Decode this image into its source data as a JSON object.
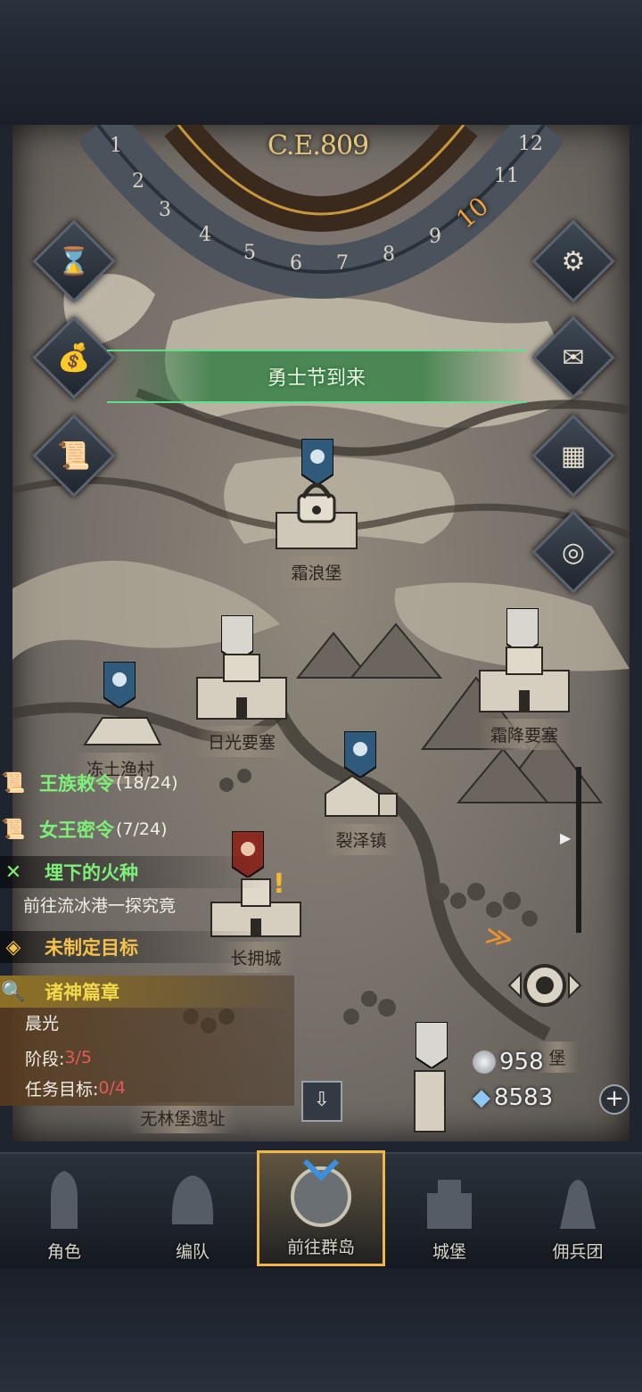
{
  "header": {
    "era": "C.E.809",
    "months": [
      "1",
      "2",
      "3",
      "4",
      "5",
      "6",
      "7",
      "8",
      "9",
      "10",
      "11",
      "12"
    ],
    "current_month": "10"
  },
  "side_buttons": {
    "left": [
      "hourglass-icon",
      "money-bag-icon",
      "scroll-icon"
    ],
    "right": [
      "gear-icon",
      "mail-icon",
      "board-icon",
      "drum-icon"
    ]
  },
  "event_banner": "勇士节到来",
  "locations": {
    "frost_wave_fort": "霜浪堡",
    "sunlight_fortress": "日光要塞",
    "frost_fortress": "霜降要塞",
    "frozen_fishing_village": "冻土渔村",
    "rift_town": "裂泽镇",
    "embrace_city": "长拥城",
    "ruins": "无林堡遗址",
    "fort_partial": "堡"
  },
  "quests": {
    "royal_decree": {
      "title": "王族敕令",
      "progress": "(18/24)"
    },
    "queen_secret": {
      "title": "女王密令",
      "progress": "(7/24)"
    },
    "buried_fire": {
      "title": "埋下的火种",
      "desc": "前往流冰港一探究竟"
    },
    "no_goal": {
      "title": "未制定目标"
    },
    "gods_chapter": {
      "title": "诸神篇章",
      "name": "晨光",
      "stage_label": "阶段:",
      "stage_value": "3/5",
      "goal_label": "任务目标:",
      "goal_value": "0/4"
    }
  },
  "resources": {
    "silver": "958",
    "crystal": "8583"
  },
  "tabs": [
    {
      "label": "角色",
      "icon": "knight-icon"
    },
    {
      "label": "编队",
      "icon": "helmet-icon"
    },
    {
      "label": "前往群岛",
      "icon": "compass-icon",
      "active": true
    },
    {
      "label": "城堡",
      "icon": "castle-icon"
    },
    {
      "label": "佣兵团",
      "icon": "mercenary-icon"
    }
  ],
  "colors": {
    "quest_green": "#7df07a",
    "quest_orange": "#f5c24c",
    "quest_yellow": "#f2d94a",
    "progress_red": "#e45a5a",
    "accent_gold": "#f2b54a"
  }
}
